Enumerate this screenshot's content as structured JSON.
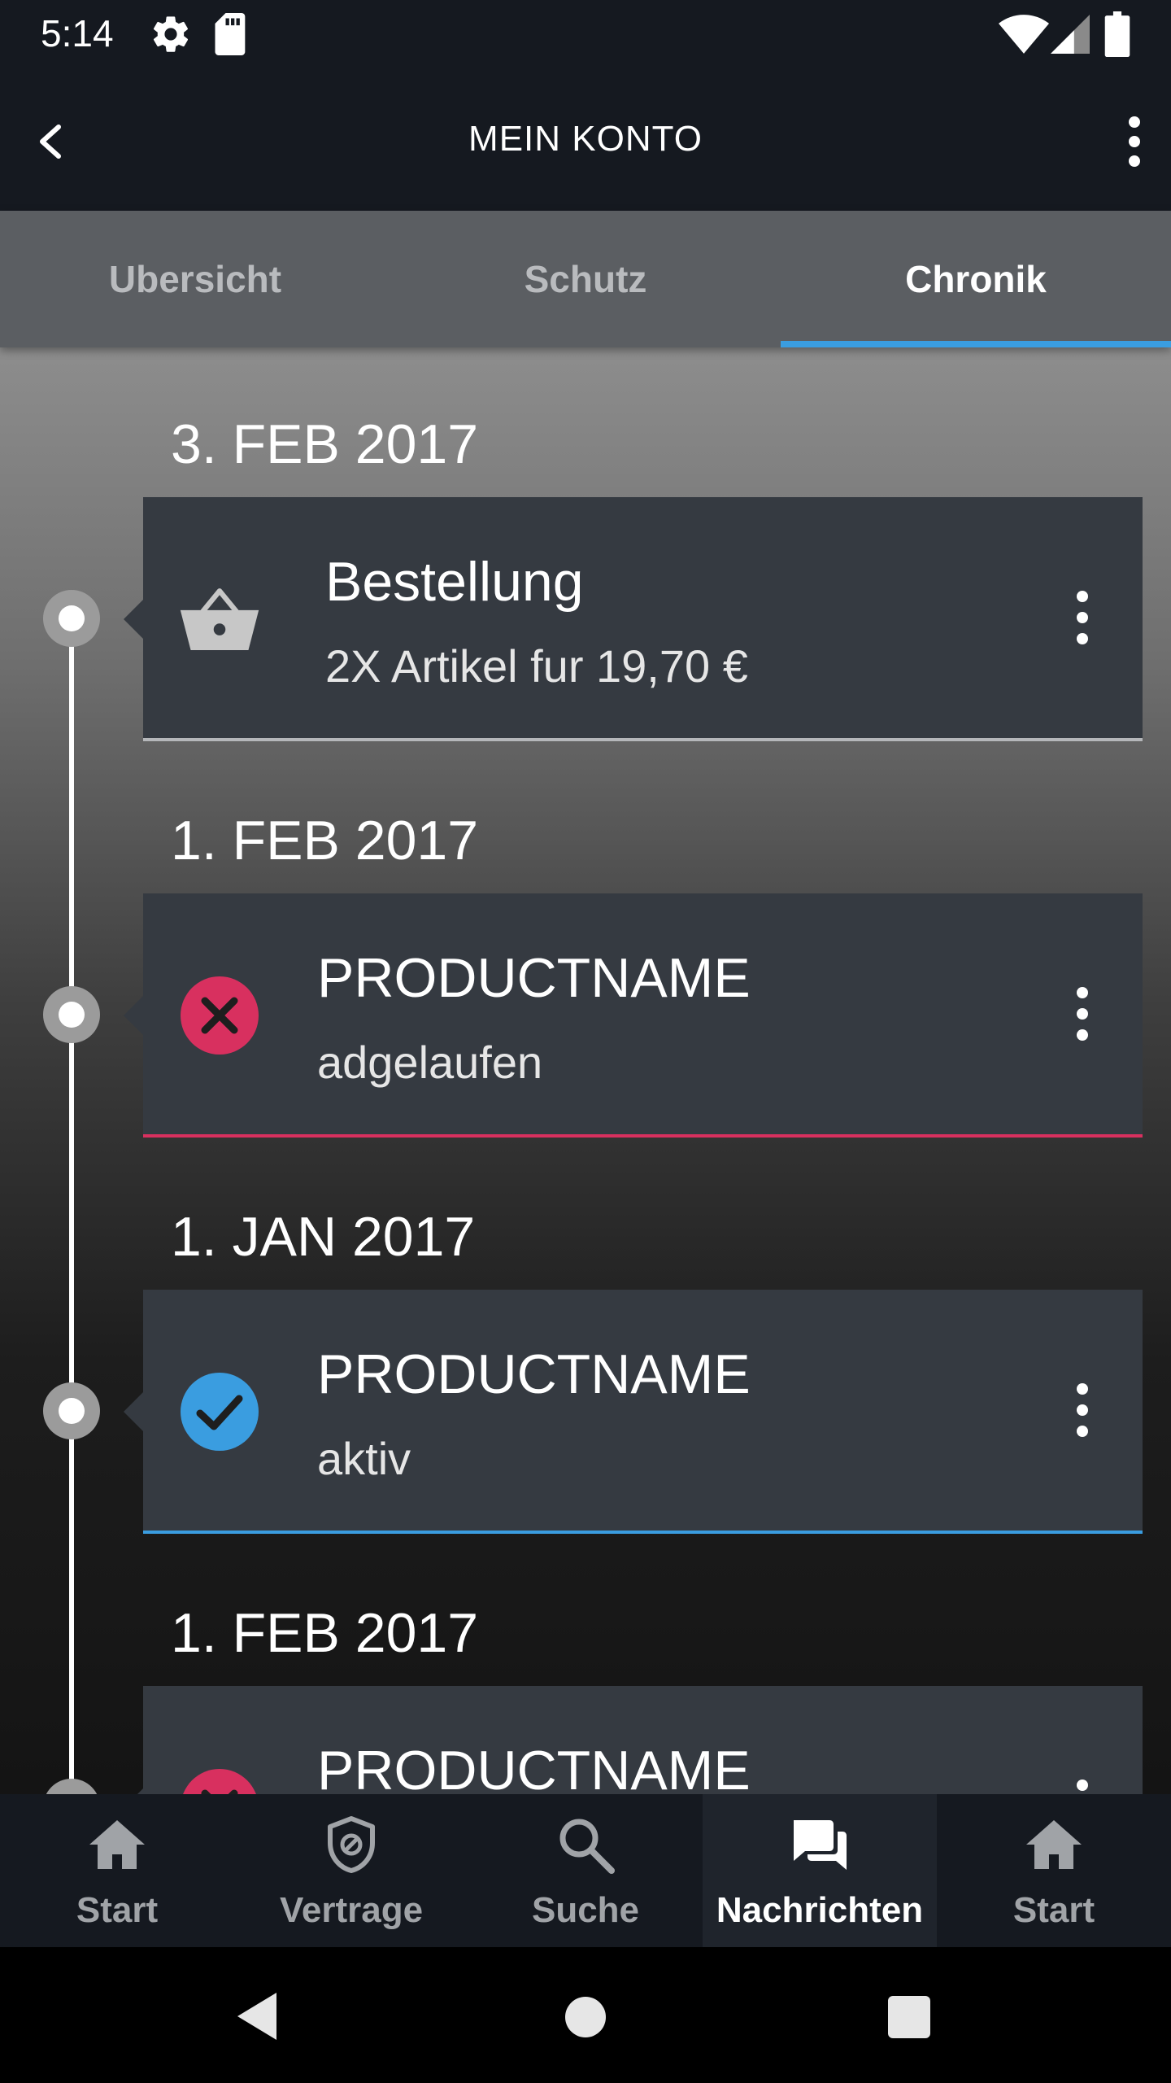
{
  "status_bar": {
    "time": "5:14",
    "icons": [
      "gear-icon",
      "sd-card-icon",
      "wifi-icon",
      "signal-icon",
      "battery-icon"
    ]
  },
  "app_bar": {
    "title": "MEIN KONTO",
    "back_icon": "chevron-left-icon",
    "menu_icon": "more-vert-icon"
  },
  "tabs": [
    {
      "label": "Ubersicht",
      "active": false
    },
    {
      "label": "Schutz",
      "active": false
    },
    {
      "label": "Chronik",
      "active": true
    }
  ],
  "timeline": [
    {
      "date": "3. FEB 2017",
      "title": "Bestellung",
      "subtitle": "2X Artikel fur 19,70 €",
      "icon": "basket-icon",
      "status_color": "#b5b7ba"
    },
    {
      "date": "1. FEB 2017",
      "title": "PRODUCTNAME",
      "subtitle": "adgelaufen",
      "icon": "error-x-icon",
      "status_color": "#d8305f"
    },
    {
      "date": "1. JAN 2017",
      "title": "PRODUCTNAME",
      "subtitle": "aktiv",
      "icon": "check-icon",
      "status_color": "#3a9de0"
    },
    {
      "date": "1. FEB 2017",
      "title": "PRODUCTNAME",
      "subtitle": "",
      "icon": "error-x-icon",
      "status_color": "#d8305f"
    }
  ],
  "bottom_nav": [
    {
      "label": "Start",
      "icon": "home-icon",
      "active": false
    },
    {
      "label": "Vertrage",
      "icon": "shield-icon",
      "active": false
    },
    {
      "label": "Suche",
      "icon": "search-icon",
      "active": false
    },
    {
      "label": "Nachrichten",
      "icon": "chat-icon",
      "active": true
    },
    {
      "label": "Start",
      "icon": "home-icon",
      "active": false
    }
  ],
  "colors": {
    "accent": "#3a9de0",
    "error": "#d8305f",
    "card_bg": "#353a41",
    "bar_bg": "#151920"
  }
}
